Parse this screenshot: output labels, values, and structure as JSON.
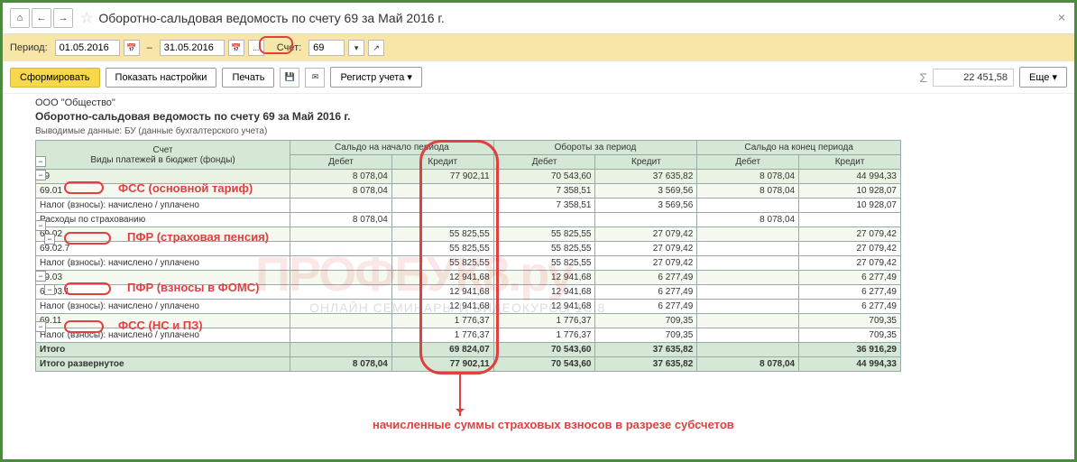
{
  "window": {
    "title": "Оборотно-сальдовая ведомость по счету 69 за Май 2016 г."
  },
  "period": {
    "label": "Период:",
    "from": "01.05.2016",
    "dash": "–",
    "to": "31.05.2016",
    "account_label": "Счет:",
    "account": "69"
  },
  "toolbar": {
    "form": "Сформировать",
    "show_settings": "Показать настройки",
    "print": "Печать",
    "register": "Регистр учета",
    "more": "Еще"
  },
  "summary": {
    "total": "22 451,58"
  },
  "report": {
    "org": "ООО \"Общество\"",
    "title": "Оборотно-сальдовая ведомость по счету 69 за Май 2016 г.",
    "subtitle": "Выводимые данные: БУ (данные бухгалтерского учета)",
    "head": {
      "c1": "Счет",
      "c2": "Сальдо на начало периода",
      "c3": "Обороты за период",
      "c4": "Сальдо на конец периода",
      "sub1": "Виды платежей в бюджет (фонды)",
      "d": "Дебет",
      "k": "Кредит"
    },
    "rows": [
      {
        "cls": "row-acct",
        "name": "69",
        "v": [
          "8 078,04",
          "77 902,11",
          "70 543,60",
          "37 635,82",
          "8 078,04",
          "44 994,33"
        ]
      },
      {
        "cls": "row-sub",
        "name": "69.01",
        "v": [
          "8 078,04",
          "",
          "7 358,51",
          "3 569,56",
          "8 078,04",
          "10 928,07"
        ]
      },
      {
        "cls": "",
        "name": "Налог (взносы): начислено / уплачено",
        "v": [
          "",
          "",
          "7 358,51",
          "3 569,56",
          "",
          "10 928,07"
        ]
      },
      {
        "cls": "",
        "name": "Расходы по страхованию",
        "v": [
          "8 078,04",
          "",
          "",
          "",
          "8 078,04",
          ""
        ]
      },
      {
        "cls": "row-sub",
        "name": "69.02",
        "v": [
          "",
          "55 825,55",
          "55 825,55",
          "27 079,42",
          "",
          "27 079,42"
        ]
      },
      {
        "cls": "",
        "name": "69.02.7",
        "v": [
          "",
          "55 825,55",
          "55 825,55",
          "27 079,42",
          "",
          "27 079,42"
        ]
      },
      {
        "cls": "",
        "name": "Налог (взносы): начислено / уплачено",
        "v": [
          "",
          "55 825,55",
          "55 825,55",
          "27 079,42",
          "",
          "27 079,42"
        ]
      },
      {
        "cls": "row-sub",
        "name": "69.03",
        "v": [
          "",
          "12 941,68",
          "12 941,68",
          "6 277,49",
          "",
          "6 277,49"
        ]
      },
      {
        "cls": "",
        "name": "69.03.1",
        "v": [
          "",
          "12 941,68",
          "12 941,68",
          "6 277,49",
          "",
          "6 277,49"
        ]
      },
      {
        "cls": "",
        "name": "Налог (взносы): начислено / уплачено",
        "v": [
          "",
          "12 941,68",
          "12 941,68",
          "6 277,49",
          "",
          "6 277,49"
        ]
      },
      {
        "cls": "row-sub",
        "name": "69.11",
        "v": [
          "",
          "1 776,37",
          "1 776,37",
          "709,35",
          "",
          "709,35"
        ]
      },
      {
        "cls": "",
        "name": "Налог (взносы): начислено / уплачено",
        "v": [
          "",
          "1 776,37",
          "1 776,37",
          "709,35",
          "",
          "709,35"
        ]
      },
      {
        "cls": "row-itog",
        "name": "Итого",
        "v": [
          "",
          "69 824,07",
          "70 543,60",
          "37 635,82",
          "",
          "36 916,29"
        ]
      },
      {
        "cls": "row-itog",
        "name": "Итого развернутое",
        "v": [
          "8 078,04",
          "77 902,11",
          "70 543,60",
          "37 635,82",
          "8 078,04",
          "44 994,33"
        ]
      }
    ]
  },
  "annotations": {
    "a1": "ФСС (основной тариф)",
    "a2": "ПФР (страховая пенсия)",
    "a3": "ПФР (взносы в ФОМС)",
    "a4": "ФСС (НС и ПЗ)",
    "bottom": "начисленные суммы страховых взносов в разрезе субсчетов"
  },
  "watermark": {
    "big": "ПРОФБУК8.ру",
    "sub": "ОНЛАЙН СЕМИНАРЫ И ВИДЕОКУРСЫ 1С:8"
  }
}
